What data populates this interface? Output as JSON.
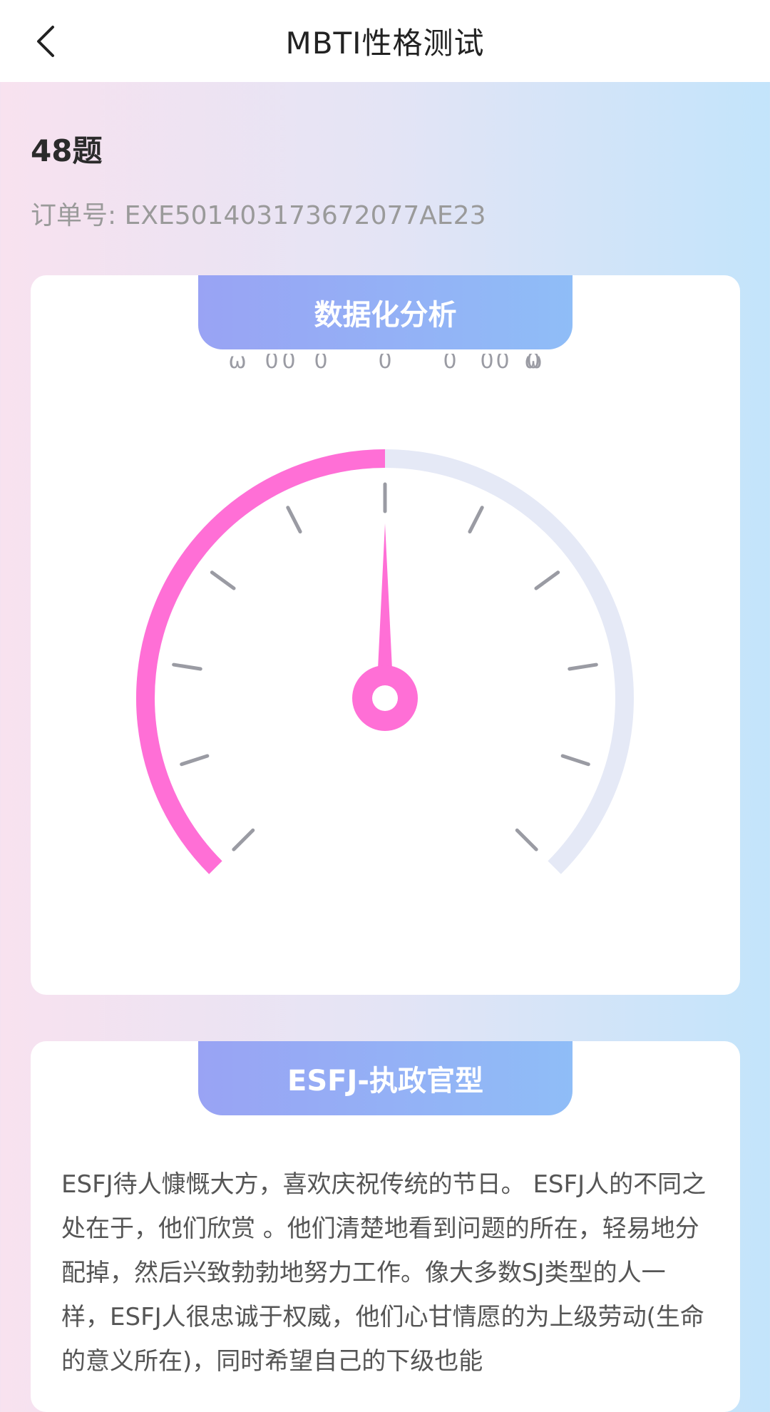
{
  "header": {
    "title": "MBTI性格测试",
    "back_icon": "chevron-left-icon"
  },
  "summary": {
    "question_count": "48题",
    "order_number": "订单号: EXE501403173672077AE23"
  },
  "gauge_card": {
    "tab_label": "数据化分析",
    "scale_labels": [
      "ω",
      "0",
      "0",
      "0",
      "0",
      "0",
      "0",
      "0",
      "0",
      "ω"
    ],
    "fill_fraction": 0.5,
    "colors": {
      "fill": "#ff6fd6",
      "track": "#e5e9f6",
      "tick": "#9a9ba3",
      "needle": "#ff6fd6"
    }
  },
  "type_card": {
    "tab_label": "ESFJ-执政官型",
    "description": "ESFJ待人慷慨大方，喜欢庆祝传统的节日。 ESFJ人的不同之处在于，他们欣赏 。他们清楚地看到问题的所在，轻易地分配掉，然后兴致勃勃地努力工作。像大多数SJ类型的人一样，ESFJ人很忠诚于权威，他们心甘情愿的为上级劳动(生命的意义所在)，同时希望自己的下级也能"
  },
  "theme": {
    "accent_gradient": [
      "#99a3f4",
      "#8fbdf7"
    ],
    "bg_gradient": [
      "#f8e2ef",
      "#c3e4fb"
    ]
  }
}
